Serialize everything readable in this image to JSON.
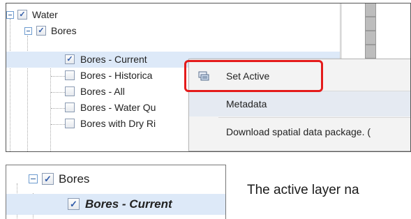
{
  "layer_tree": {
    "items": [
      {
        "label": "Water",
        "checked": true,
        "expanded": true
      },
      {
        "label": "Bores",
        "checked": true,
        "expanded": true
      },
      {
        "label": "Bores - Current",
        "checked": true,
        "selected": true
      },
      {
        "label": "Bores - Historica",
        "checked": false
      },
      {
        "label": "Bores - All",
        "checked": false
      },
      {
        "label": "Bores - Water Qu",
        "checked": false
      },
      {
        "label": "Bores with Dry Ri",
        "checked": false
      }
    ],
    "check_glyph": "✓"
  },
  "context_menu": {
    "items": [
      {
        "label": "Set Active",
        "icon": "layers-icon",
        "outlined": true
      },
      {
        "label": "Metadata",
        "icon": ""
      },
      {
        "label": "Download spatial data package. (",
        "icon": ""
      }
    ],
    "outline_color": "#e41b1b"
  },
  "active_layer_view": {
    "parent_label": "Bores",
    "active_label": "Bores - Current"
  },
  "caption": "The active layer na"
}
